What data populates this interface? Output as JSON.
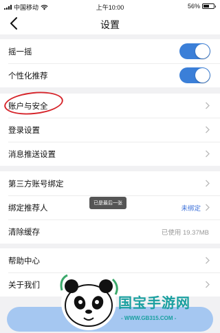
{
  "status_bar": {
    "carrier": "中国移动",
    "time": "上午10:00",
    "battery_percent": "56%",
    "battery_level": 0.56
  },
  "nav": {
    "title": "设置",
    "back_icon": "chevron-left-icon"
  },
  "groups": [
    {
      "rows": [
        {
          "label": "摇一摇",
          "control": "toggle",
          "on": true
        },
        {
          "label": "个性化推荐",
          "control": "toggle",
          "on": true
        }
      ]
    },
    {
      "rows": [
        {
          "label": "账户与安全",
          "control": "chevron"
        },
        {
          "label": "登录设置",
          "control": "chevron"
        },
        {
          "label": "消息推送设置",
          "control": "chevron"
        }
      ]
    },
    {
      "rows": [
        {
          "label": "第三方账号绑定",
          "control": "chevron"
        },
        {
          "label": "绑定推荐人",
          "control": "chevron",
          "value": "未绑定"
        },
        {
          "label": "清除缓存",
          "control": "value",
          "value": "已使用 19.37MB"
        }
      ]
    },
    {
      "rows": [
        {
          "label": "帮助中心",
          "control": "chevron"
        },
        {
          "label": "关于我们",
          "control": "chevron"
        }
      ]
    }
  ],
  "toast": {
    "text": "已是最后一张"
  },
  "colors": {
    "accent": "#3b7fd8",
    "annotation_circle": "#d6252b",
    "watermark": "#1aa0a0"
  },
  "watermark": {
    "text": "国宝手游网",
    "url": "- WWW.GB315.COM -",
    "logo_icon": "panda-logo-icon"
  }
}
